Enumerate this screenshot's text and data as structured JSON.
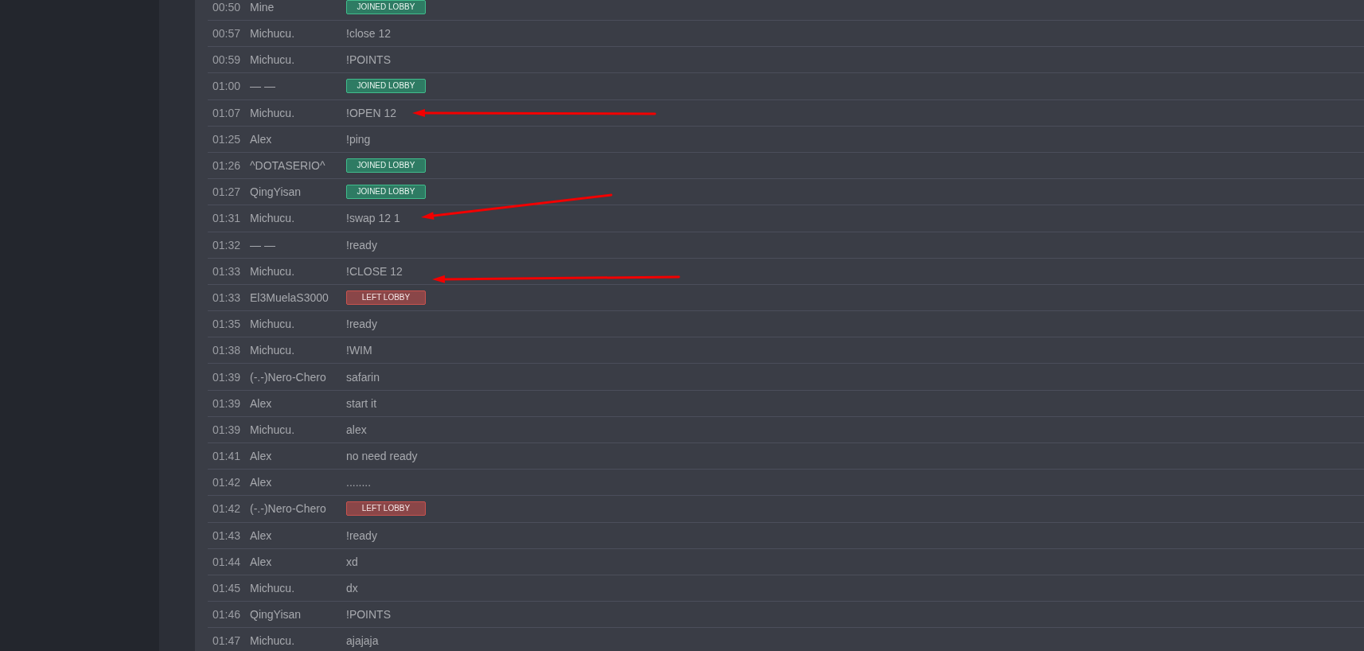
{
  "chat_log": {
    "rows": [
      {
        "time": "00:50",
        "player": "Mine",
        "kind": "joined",
        "text": "JOINED LOBBY"
      },
      {
        "time": "00:57",
        "player": "Michucu.",
        "kind": "chat",
        "text": "!close 12"
      },
      {
        "time": "00:59",
        "player": "Michucu.",
        "kind": "chat",
        "text": "!POINTS"
      },
      {
        "time": "01:00",
        "player": "— —",
        "kind": "joined",
        "text": "JOINED LOBBY"
      },
      {
        "time": "01:07",
        "player": "Michucu.",
        "kind": "chat",
        "text": "!OPEN 12"
      },
      {
        "time": "01:25",
        "player": "Alex",
        "kind": "chat",
        "text": "!ping"
      },
      {
        "time": "01:26",
        "player": "^DOTASERIO^",
        "kind": "joined",
        "text": "JOINED LOBBY"
      },
      {
        "time": "01:27",
        "player": "QingYisan",
        "kind": "joined",
        "text": "JOINED LOBBY"
      },
      {
        "time": "01:31",
        "player": "Michucu.",
        "kind": "chat",
        "text": "!swap 12 1"
      },
      {
        "time": "01:32",
        "player": "— —",
        "kind": "chat",
        "text": "!ready"
      },
      {
        "time": "01:33",
        "player": "Michucu.",
        "kind": "chat",
        "text": "!CLOSE 12"
      },
      {
        "time": "01:33",
        "player": "El3MuelaS3000",
        "kind": "left",
        "text": "LEFT LOBBY"
      },
      {
        "time": "01:35",
        "player": "Michucu.",
        "kind": "chat",
        "text": "!ready"
      },
      {
        "time": "01:38",
        "player": "Michucu.",
        "kind": "chat",
        "text": "!WIM"
      },
      {
        "time": "01:39",
        "player": "(-.-)Nero-Chero",
        "kind": "chat",
        "text": "safarin"
      },
      {
        "time": "01:39",
        "player": "Alex",
        "kind": "chat",
        "text": "start it"
      },
      {
        "time": "01:39",
        "player": "Michucu.",
        "kind": "chat",
        "text": "alex"
      },
      {
        "time": "01:41",
        "player": "Alex",
        "kind": "chat",
        "text": "no need ready"
      },
      {
        "time": "01:42",
        "player": "Alex",
        "kind": "chat",
        "text": "........"
      },
      {
        "time": "01:42",
        "player": "(-.-)Nero-Chero",
        "kind": "left",
        "text": "LEFT LOBBY"
      },
      {
        "time": "01:43",
        "player": "Alex",
        "kind": "chat",
        "text": "!ready"
      },
      {
        "time": "01:44",
        "player": "Alex",
        "kind": "chat",
        "text": "xd"
      },
      {
        "time": "01:45",
        "player": "Michucu.",
        "kind": "chat",
        "text": "dx"
      },
      {
        "time": "01:46",
        "player": "QingYisan",
        "kind": "chat",
        "text": "!POINTS"
      },
      {
        "time": "01:47",
        "player": "Michucu.",
        "kind": "chat",
        "text": "ajajaja"
      }
    ]
  }
}
